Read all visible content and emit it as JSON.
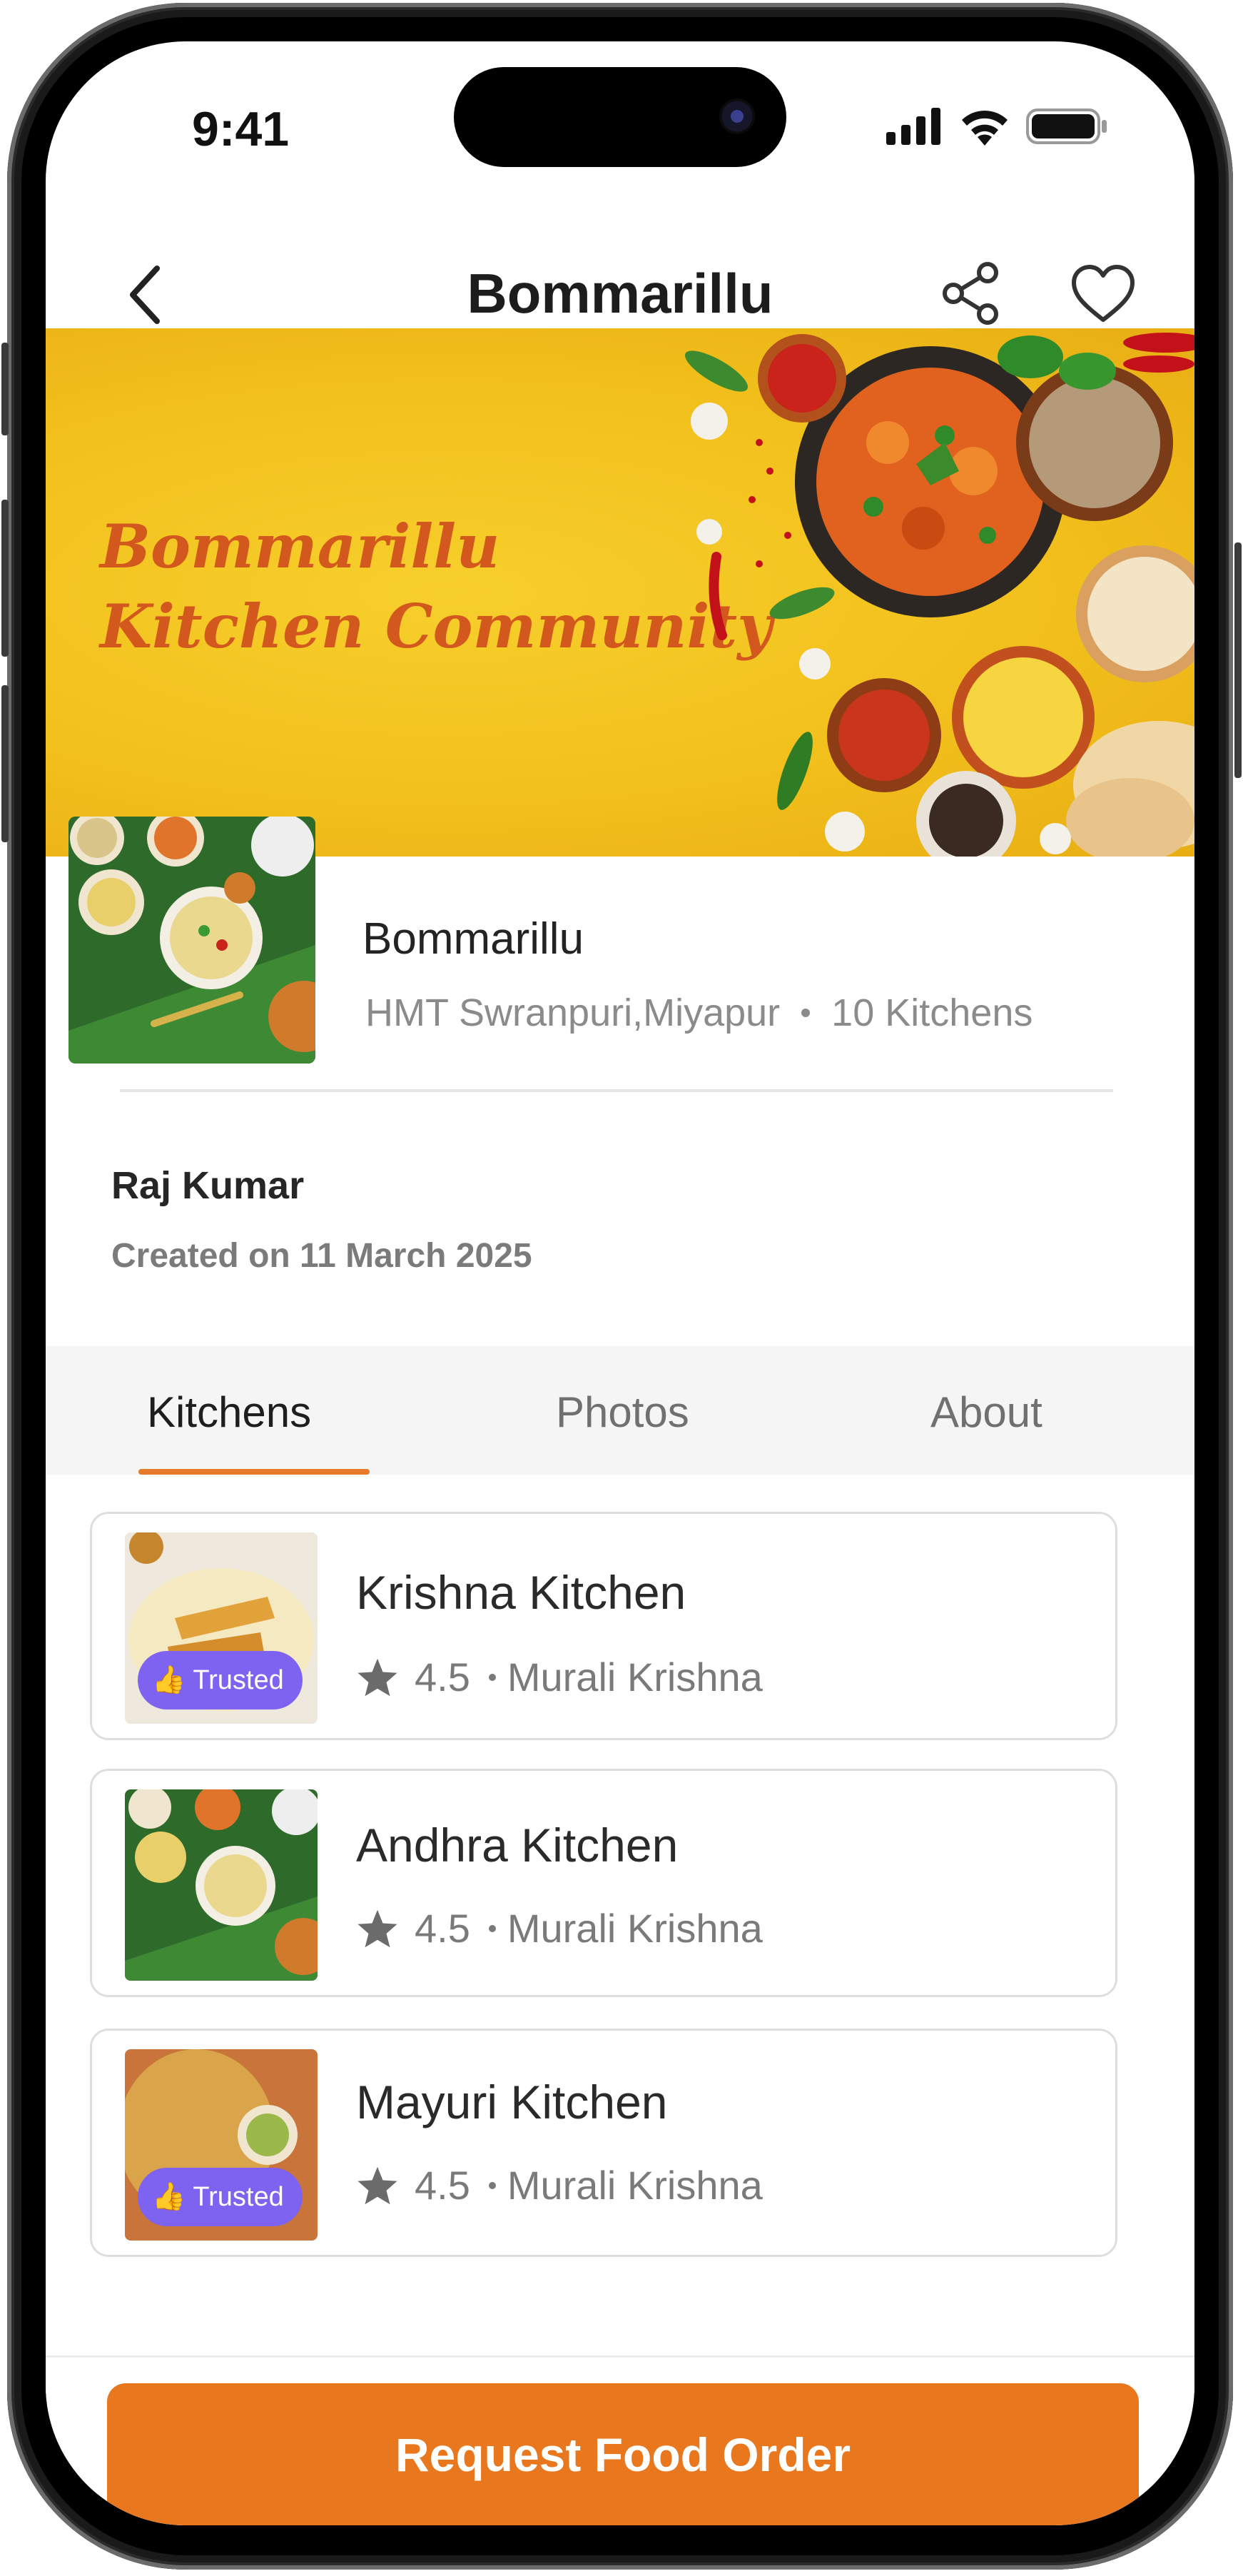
{
  "status_bar": {
    "time": "9:41"
  },
  "header": {
    "title": "Bommarillu"
  },
  "banner": {
    "line1": "Bommarillu",
    "line2": "Kitchen Community"
  },
  "community": {
    "name": "Bommarillu",
    "location": "HMT Swranpuri,Miyapur",
    "kitchens_count": "10 Kitchens"
  },
  "creator": {
    "name": "Raj Kumar",
    "created": "Created on 11 March 2025"
  },
  "tabs": [
    {
      "label": "Kitchens",
      "active": true
    },
    {
      "label": "Photos",
      "active": false
    },
    {
      "label": "About",
      "active": false
    }
  ],
  "kitchens": [
    {
      "name": "Krishna Kitchen",
      "rating": "4.5",
      "owner": "Murali Krishna",
      "trusted": true,
      "badge": "Trusted"
    },
    {
      "name": "Andhra Kitchen",
      "rating": "4.5",
      "owner": "Murali Krishna",
      "trusted": false,
      "badge": ""
    },
    {
      "name": "Mayuri Kitchen",
      "rating": "4.5",
      "owner": "Murali Krishna",
      "trusted": true,
      "badge": "Trusted"
    }
  ],
  "cta": {
    "label": "Request Food Order"
  },
  "colors": {
    "accent": "#e8771e",
    "trusted_badge": "#7d63f0",
    "banner": "#f2c01c"
  }
}
